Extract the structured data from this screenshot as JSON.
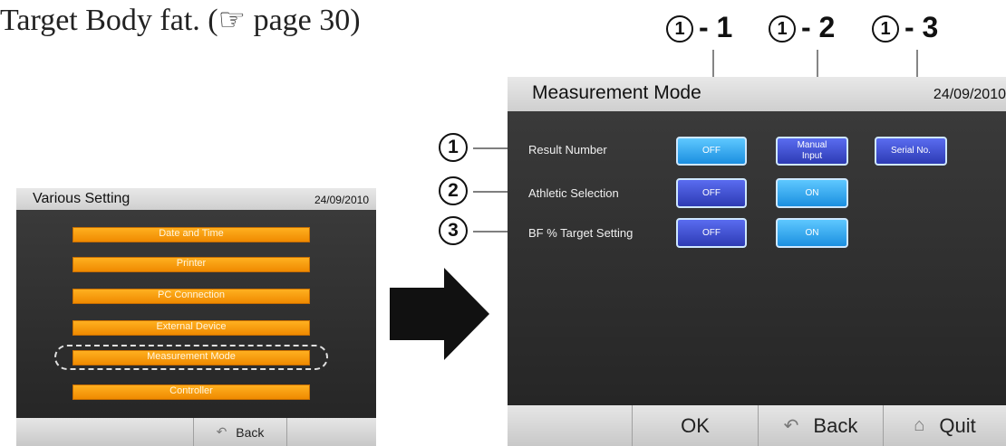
{
  "doc": {
    "intro_text": "Target Body fat. (☞ page 30)"
  },
  "callouts_top": [
    "1",
    "- 1",
    "1",
    "- 2",
    "1",
    "- 3"
  ],
  "callouts_side": [
    "1",
    "2",
    "3"
  ],
  "left_screen": {
    "title": "Various Setting",
    "date": "24/09/2010",
    "menu_items": [
      "Date and Time",
      "Printer",
      "PC Connection",
      "External Device",
      "Measurement Mode",
      "Controller"
    ],
    "back_label": "Back"
  },
  "right_screen": {
    "title": "Measurement Mode",
    "date": "24/09/2010",
    "rows": [
      {
        "label": "Result Number",
        "buttons": [
          "OFF",
          "Manual\nInput",
          "Serial No."
        ]
      },
      {
        "label": "Athletic Selection",
        "buttons": [
          "OFF",
          "ON"
        ]
      },
      {
        "label": "BF % Target Setting",
        "buttons": [
          "OFF",
          "ON"
        ]
      }
    ],
    "footer": {
      "ok": "OK",
      "back": "Back",
      "quit": "Quit"
    }
  }
}
